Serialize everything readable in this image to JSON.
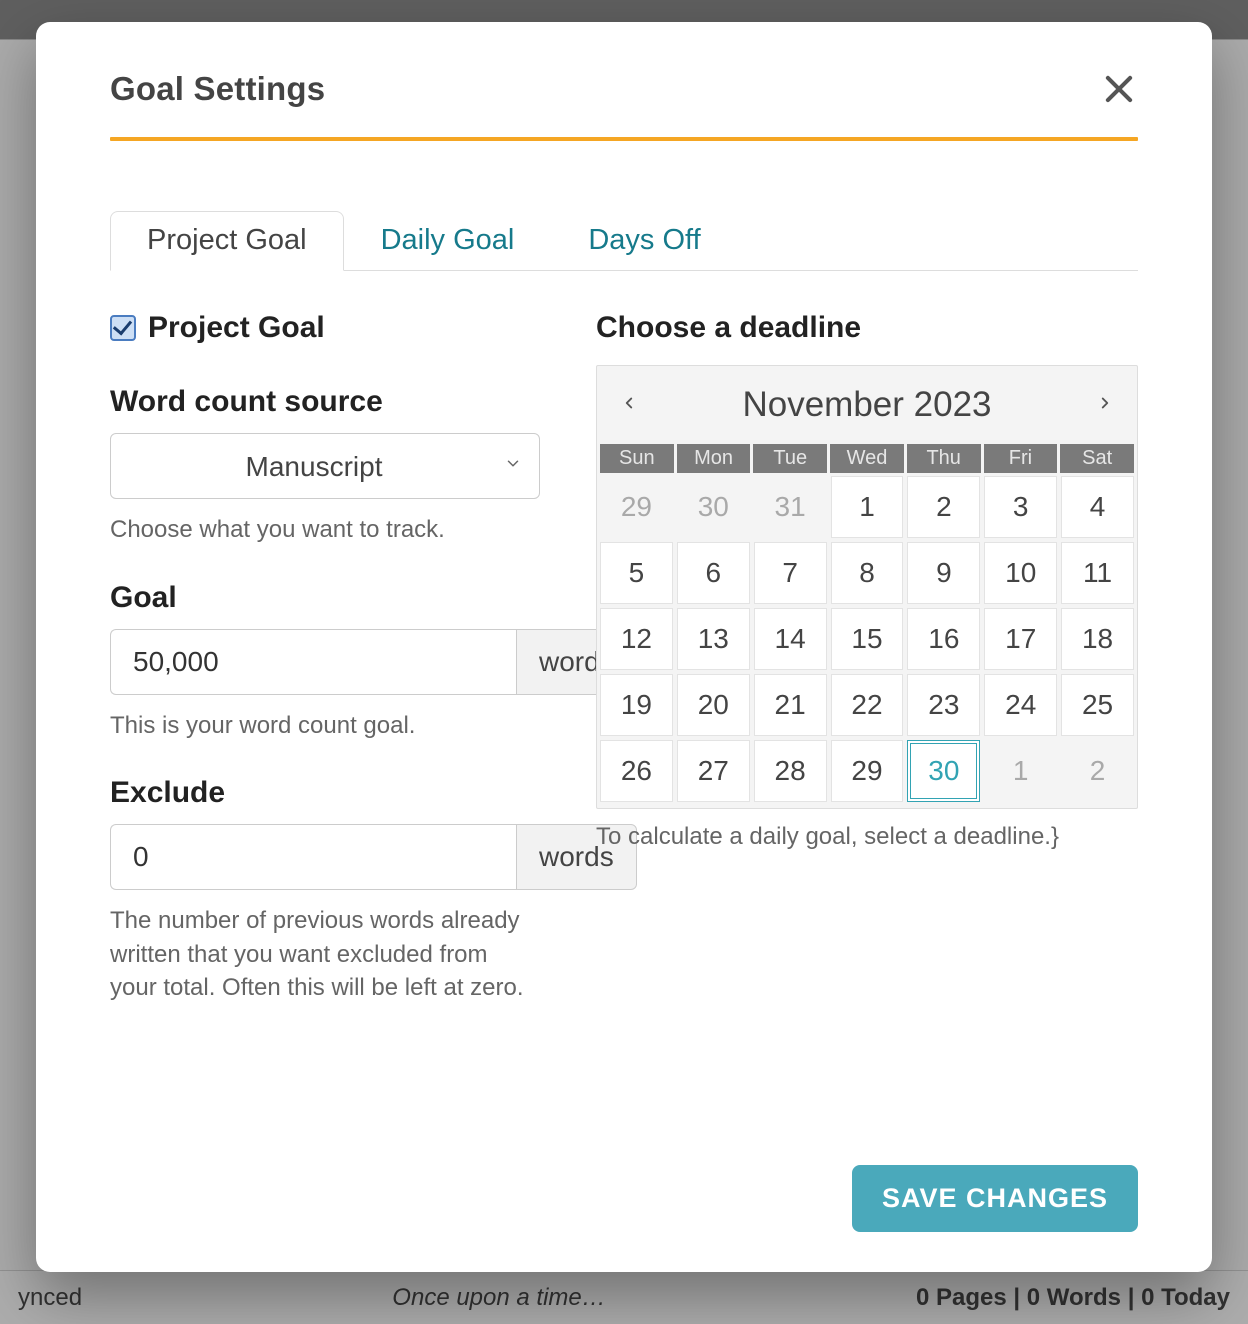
{
  "modal": {
    "title": "Goal Settings",
    "tabs": [
      {
        "label": "Project Goal",
        "active": true
      },
      {
        "label": "Daily Goal",
        "active": false
      },
      {
        "label": "Days Off",
        "active": false
      }
    ],
    "checkbox_label": "Project Goal",
    "checkbox_checked": true,
    "source": {
      "label": "Word count source",
      "value": "Manuscript",
      "help": "Choose what you want to track."
    },
    "goal": {
      "label": "Goal",
      "value": "50,000",
      "unit": "words",
      "help": "This is your word count goal."
    },
    "exclude": {
      "label": "Exclude",
      "value": "0",
      "unit": "words",
      "help": "The number of previous words already written that you want excluded from your total. Often this will be left at zero."
    },
    "deadline": {
      "label": "Choose a deadline",
      "month_label": "November 2023",
      "dow": [
        "Sun",
        "Mon",
        "Tue",
        "Wed",
        "Thu",
        "Fri",
        "Sat"
      ],
      "days": [
        {
          "n": "29",
          "muted": true
        },
        {
          "n": "30",
          "muted": true
        },
        {
          "n": "31",
          "muted": true
        },
        {
          "n": "1"
        },
        {
          "n": "2"
        },
        {
          "n": "3"
        },
        {
          "n": "4"
        },
        {
          "n": "5"
        },
        {
          "n": "6"
        },
        {
          "n": "7"
        },
        {
          "n": "8"
        },
        {
          "n": "9"
        },
        {
          "n": "10"
        },
        {
          "n": "11"
        },
        {
          "n": "12"
        },
        {
          "n": "13"
        },
        {
          "n": "14"
        },
        {
          "n": "15"
        },
        {
          "n": "16"
        },
        {
          "n": "17"
        },
        {
          "n": "18"
        },
        {
          "n": "19"
        },
        {
          "n": "20"
        },
        {
          "n": "21"
        },
        {
          "n": "22"
        },
        {
          "n": "23"
        },
        {
          "n": "24"
        },
        {
          "n": "25"
        },
        {
          "n": "26"
        },
        {
          "n": "27"
        },
        {
          "n": "28"
        },
        {
          "n": "29"
        },
        {
          "n": "30",
          "selected": true
        },
        {
          "n": "1",
          "muted": true
        },
        {
          "n": "2",
          "muted": true
        }
      ],
      "help": "To calculate a daily goal, select a deadline.}"
    },
    "save_label": "SAVE CHANGES"
  },
  "behind": {
    "left": "ynced",
    "center": "Once upon a time…",
    "right": "0 Pages | 0 Words | 0 Today"
  },
  "colors": {
    "accent": "#f5a623",
    "link": "#167a8b",
    "primary": "#4aa9bb"
  }
}
